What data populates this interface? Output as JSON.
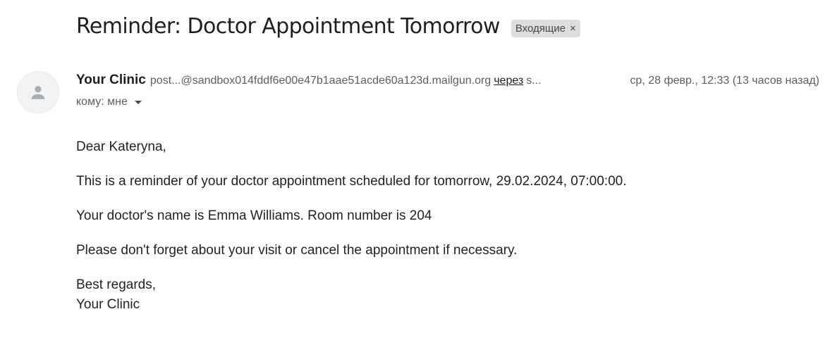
{
  "email": {
    "subject": "Reminder: Doctor Appointment Tomorrow",
    "label": {
      "text": "Входящие",
      "close_glyph": "×"
    },
    "sender": {
      "name": "Your Clinic",
      "email": "post...@sandbox014fddf6e00e47b1aae51acde60a123d.mailgun.org",
      "via_label": "через",
      "via_tail": "s...",
      "avatar_icon": "person-icon"
    },
    "date": "ср, 28 февр., 12:33 (13 часов назад)",
    "recipient": {
      "text": "кому: мне"
    },
    "body": {
      "greeting": "Dear Kateryna,",
      "line1": "This is a reminder of your doctor appointment scheduled for tomorrow, 29.02.2024, 07:00:00.",
      "line2": "Your doctor's name is Emma Williams. Room number is 204",
      "line3": "Please don't forget about your visit or cancel the appointment if necessary.",
      "closing": "Best regards,",
      "signature": "Your Clinic"
    }
  }
}
